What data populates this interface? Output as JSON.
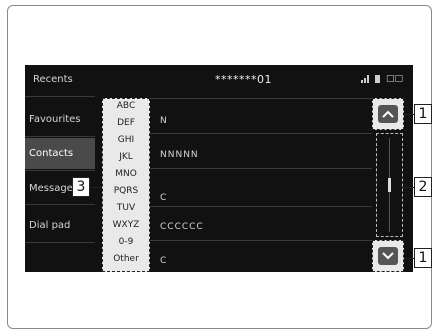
{
  "sidebar": {
    "items": [
      {
        "label": "Recents"
      },
      {
        "label": "Favourites"
      },
      {
        "label": "Contacts"
      },
      {
        "label": "Messages"
      },
      {
        "label": "Dial pad"
      }
    ]
  },
  "header": {
    "number": "*******01",
    "signal_icon": "signal-bars-icon",
    "battery_icon": "battery-icon",
    "status_text": "□□"
  },
  "index_panel": {
    "items": [
      "ABC",
      "DEF",
      "GHI",
      "JKL",
      "MNO",
      "PQRS",
      "TUV",
      "WXYZ",
      "0-9",
      "Other"
    ]
  },
  "contact_list": {
    "entries": [
      "N",
      "NNNNN",
      "",
      "C",
      "CCCCCC",
      "C"
    ]
  },
  "scroll": {
    "up_icon": "chevron-up-icon",
    "down_icon": "chevron-down-icon"
  },
  "callouts": {
    "scroll_buttons": "1",
    "scroll_bar": "2",
    "index": "3"
  },
  "colors": {
    "screen_bg": "#111111",
    "active_item_bg": "#4a4a4a",
    "index_bg": "#e9e9e9"
  }
}
